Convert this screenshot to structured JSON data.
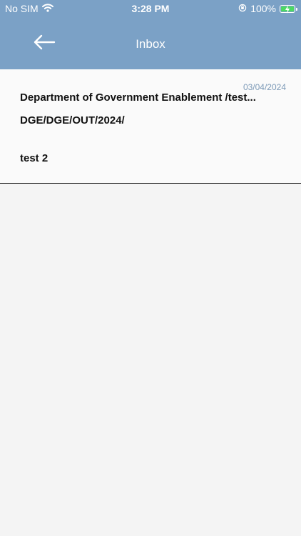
{
  "status_bar": {
    "carrier": "No SIM",
    "time": "3:28 PM",
    "battery_percent": "100%",
    "icons": [
      "wifi-icon",
      "orientation-lock-icon",
      "battery-charging-icon"
    ]
  },
  "nav": {
    "title": "Inbox",
    "back_icon": "back-arrow-icon"
  },
  "inbox": {
    "items": [
      {
        "date": "03/04/2024",
        "title": "Department of Government Enablement /test...",
        "reference": "DGE/DGE/OUT/2024/",
        "subject": "test 2"
      }
    ]
  },
  "colors": {
    "header_bg": "#7ba1c6",
    "page_bg": "#f4f4f4",
    "date_text": "#7e9bb8",
    "battery_fill": "#4cd964"
  }
}
